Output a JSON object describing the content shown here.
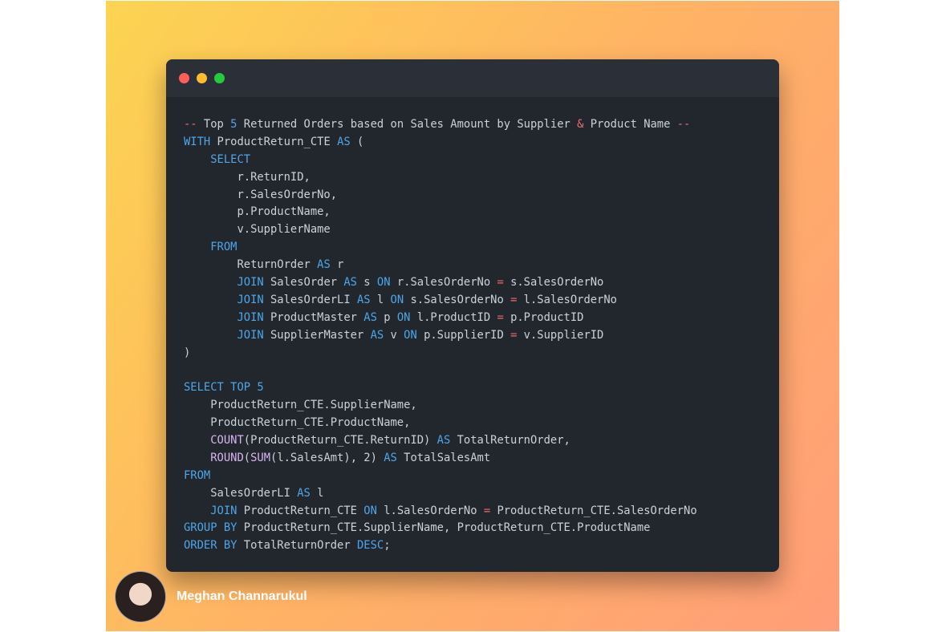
{
  "window": {
    "buttons": [
      "close",
      "minimize",
      "maximize"
    ]
  },
  "code": {
    "lines": [
      [
        {
          "t": "--",
          "c": "op"
        },
        {
          "t": " Top ",
          "c": "cm"
        },
        {
          "t": "5",
          "c": "num"
        },
        {
          "t": " Returned Orders based on Sales Amount by Supplier ",
          "c": "cm"
        },
        {
          "t": "&",
          "c": "op"
        },
        {
          "t": " Product Name ",
          "c": "cm"
        },
        {
          "t": "--",
          "c": "op"
        }
      ],
      [
        {
          "t": "WITH",
          "c": "kw"
        },
        {
          "t": " ProductReturn_CTE ",
          "c": "id"
        },
        {
          "t": "AS",
          "c": "kw"
        },
        {
          "t": " (",
          "c": "id"
        }
      ],
      [
        {
          "t": "    ",
          "c": "id"
        },
        {
          "t": "SELECT",
          "c": "kw"
        }
      ],
      [
        {
          "t": "        r.ReturnID,",
          "c": "id"
        }
      ],
      [
        {
          "t": "        r.SalesOrderNo,",
          "c": "id"
        }
      ],
      [
        {
          "t": "        p.ProductName,",
          "c": "id"
        }
      ],
      [
        {
          "t": "        v.SupplierName",
          "c": "id"
        }
      ],
      [
        {
          "t": "    ",
          "c": "id"
        },
        {
          "t": "FROM",
          "c": "kw"
        }
      ],
      [
        {
          "t": "        ReturnOrder ",
          "c": "id"
        },
        {
          "t": "AS",
          "c": "kw"
        },
        {
          "t": " r",
          "c": "id"
        }
      ],
      [
        {
          "t": "        ",
          "c": "id"
        },
        {
          "t": "JOIN",
          "c": "kw"
        },
        {
          "t": " SalesOrder ",
          "c": "id"
        },
        {
          "t": "AS",
          "c": "kw"
        },
        {
          "t": " s ",
          "c": "id"
        },
        {
          "t": "ON",
          "c": "kw"
        },
        {
          "t": " r.SalesOrderNo ",
          "c": "id"
        },
        {
          "t": "=",
          "c": "op"
        },
        {
          "t": " s.SalesOrderNo",
          "c": "id"
        }
      ],
      [
        {
          "t": "        ",
          "c": "id"
        },
        {
          "t": "JOIN",
          "c": "kw"
        },
        {
          "t": " SalesOrderLI ",
          "c": "id"
        },
        {
          "t": "AS",
          "c": "kw"
        },
        {
          "t": " l ",
          "c": "id"
        },
        {
          "t": "ON",
          "c": "kw"
        },
        {
          "t": " s.SalesOrderNo ",
          "c": "id"
        },
        {
          "t": "=",
          "c": "op"
        },
        {
          "t": " l.SalesOrderNo",
          "c": "id"
        }
      ],
      [
        {
          "t": "        ",
          "c": "id"
        },
        {
          "t": "JOIN",
          "c": "kw"
        },
        {
          "t": " ProductMaster ",
          "c": "id"
        },
        {
          "t": "AS",
          "c": "kw"
        },
        {
          "t": " p ",
          "c": "id"
        },
        {
          "t": "ON",
          "c": "kw"
        },
        {
          "t": " l.ProductID ",
          "c": "id"
        },
        {
          "t": "=",
          "c": "op"
        },
        {
          "t": " p.ProductID",
          "c": "id"
        }
      ],
      [
        {
          "t": "        ",
          "c": "id"
        },
        {
          "t": "JOIN",
          "c": "kw"
        },
        {
          "t": " SupplierMaster ",
          "c": "id"
        },
        {
          "t": "AS",
          "c": "kw"
        },
        {
          "t": " v ",
          "c": "id"
        },
        {
          "t": "ON",
          "c": "kw"
        },
        {
          "t": " p.SupplierID ",
          "c": "id"
        },
        {
          "t": "=",
          "c": "op"
        },
        {
          "t": " v.SupplierID",
          "c": "id"
        }
      ],
      [
        {
          "t": ")",
          "c": "id"
        }
      ],
      [],
      [
        {
          "t": "SELECT",
          "c": "kw"
        },
        {
          "t": " ",
          "c": "id"
        },
        {
          "t": "TOP",
          "c": "kw"
        },
        {
          "t": " ",
          "c": "id"
        },
        {
          "t": "5",
          "c": "num"
        }
      ],
      [
        {
          "t": "    ProductReturn_CTE.SupplierName,",
          "c": "id"
        }
      ],
      [
        {
          "t": "    ProductReturn_CTE.ProductName,",
          "c": "id"
        }
      ],
      [
        {
          "t": "    ",
          "c": "id"
        },
        {
          "t": "COUNT",
          "c": "fn"
        },
        {
          "t": "(ProductReturn_CTE.ReturnID) ",
          "c": "id"
        },
        {
          "t": "AS",
          "c": "kw"
        },
        {
          "t": " TotalReturnOrder,",
          "c": "id"
        }
      ],
      [
        {
          "t": "    ",
          "c": "id"
        },
        {
          "t": "ROUND",
          "c": "fn"
        },
        {
          "t": "(",
          "c": "id"
        },
        {
          "t": "SUM",
          "c": "fn"
        },
        {
          "t": "(l.SalesAmt), 2) ",
          "c": "id"
        },
        {
          "t": "AS",
          "c": "kw"
        },
        {
          "t": " TotalSalesAmt",
          "c": "id"
        }
      ],
      [
        {
          "t": "FROM",
          "c": "kw"
        }
      ],
      [
        {
          "t": "    SalesOrderLI ",
          "c": "id"
        },
        {
          "t": "AS",
          "c": "kw"
        },
        {
          "t": " l",
          "c": "id"
        }
      ],
      [
        {
          "t": "    ",
          "c": "id"
        },
        {
          "t": "JOIN",
          "c": "kw"
        },
        {
          "t": " ProductReturn_CTE ",
          "c": "id"
        },
        {
          "t": "ON",
          "c": "kw"
        },
        {
          "t": " l.SalesOrderNo ",
          "c": "id"
        },
        {
          "t": "=",
          "c": "op"
        },
        {
          "t": " ProductReturn_CTE.SalesOrderNo",
          "c": "id"
        }
      ],
      [
        {
          "t": "GROUP BY",
          "c": "kw"
        },
        {
          "t": " ProductReturn_CTE.SupplierName, ProductReturn_CTE.ProductName",
          "c": "id"
        }
      ],
      [
        {
          "t": "ORDER BY",
          "c": "kw"
        },
        {
          "t": " TotalReturnOrder ",
          "c": "id"
        },
        {
          "t": "DESC",
          "c": "kw"
        },
        {
          "t": ";",
          "c": "id"
        }
      ]
    ]
  },
  "author": {
    "name": "Meghan Channarukul"
  },
  "colors": {
    "keyword": "#4ea5e8",
    "function": "#d8b3f0",
    "operator": "#f26c6c",
    "text": "#c9d1d9",
    "editor_bg": "#22272e",
    "titlebar_bg": "#2b3038"
  }
}
